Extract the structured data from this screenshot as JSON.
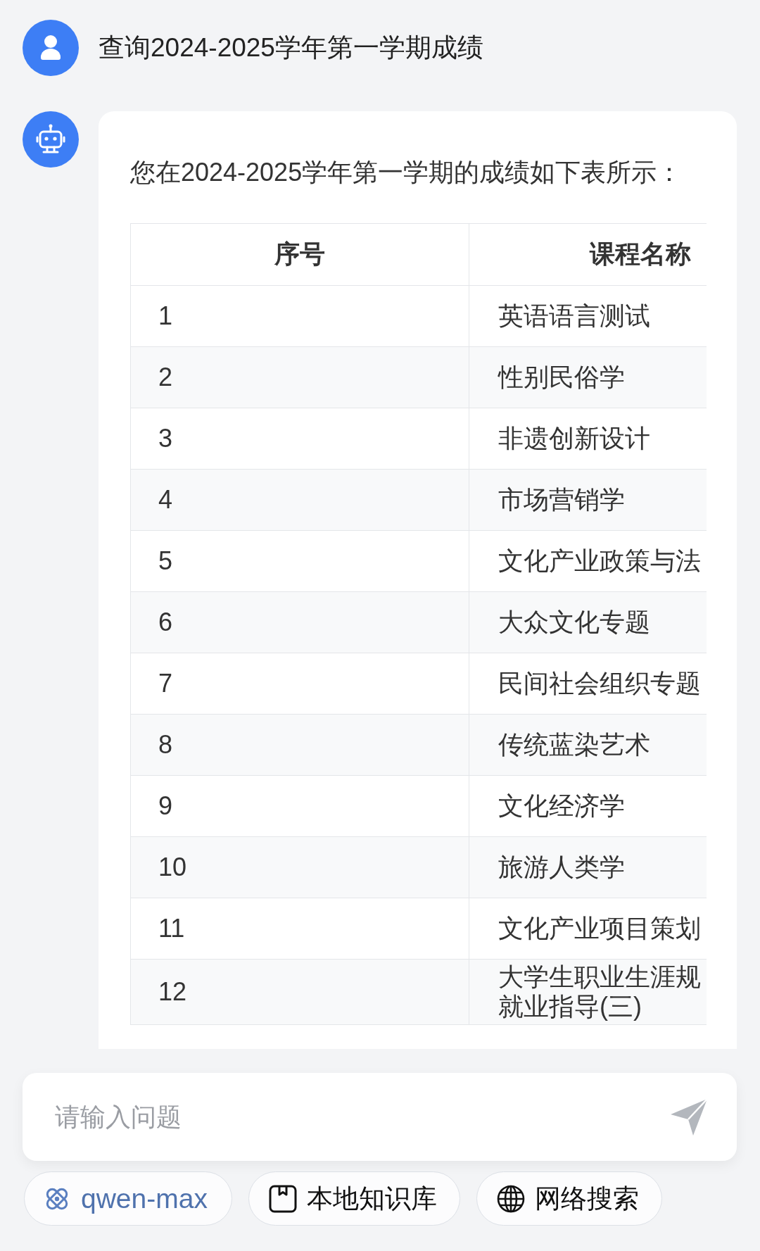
{
  "messages": [
    {
      "kind": "user",
      "text": "查询2024-2025学年第一学期成绩"
    },
    {
      "kind": "bot",
      "text": "您在2024-2025学年第一学期的成绩如下表所示：",
      "table": {
        "columns": [
          "序号",
          "课程名称"
        ],
        "rows": [
          [
            "1",
            "英语语言测试"
          ],
          [
            "2",
            "性别民俗学"
          ],
          [
            "3",
            "非遗创新设计"
          ],
          [
            "4",
            "市场营销学"
          ],
          [
            "5",
            "文化产业政策与法"
          ],
          [
            "6",
            "大众文化专题"
          ],
          [
            "7",
            "民间社会组织专题"
          ],
          [
            "8",
            "传统蓝染艺术"
          ],
          [
            "9",
            "文化经济学"
          ],
          [
            "10",
            "旅游人类学"
          ],
          [
            "11",
            "文化产业项目策划"
          ],
          [
            "12",
            "大学生职业生涯规就业指导(三)"
          ]
        ]
      }
    }
  ],
  "input": {
    "placeholder": "请输入问题"
  },
  "chips": [
    {
      "kind": "model",
      "label": "qwen-max"
    },
    {
      "kind": "knowledge",
      "label": "本地知识库"
    },
    {
      "kind": "web",
      "label": "网络搜索"
    }
  ]
}
